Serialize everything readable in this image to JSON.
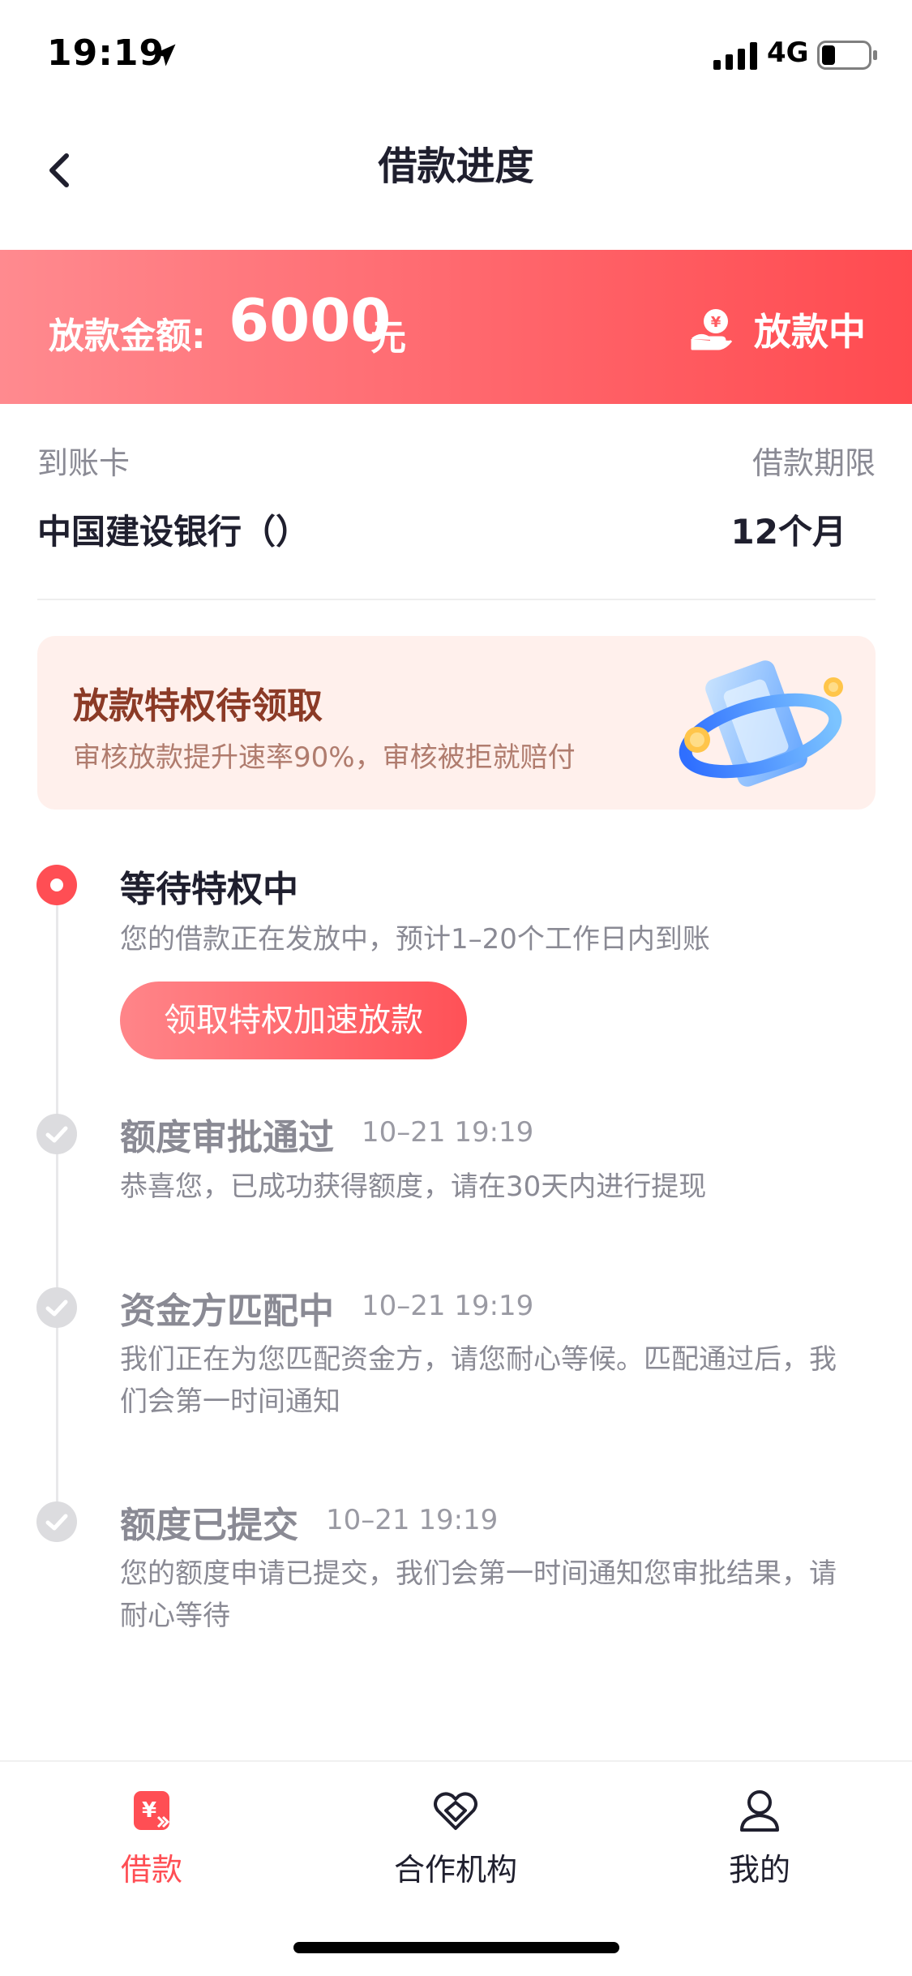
{
  "status_bar": {
    "time": "19:19",
    "network": "4G"
  },
  "header": {
    "title": "借款进度"
  },
  "banner": {
    "amount_label": "放款金额:",
    "amount_value": "6000",
    "amount_unit": "元",
    "status": "放款中"
  },
  "card_info": {
    "card_label": "到账卡",
    "card_value": "中国建设银行（）",
    "term_label": "借款期限",
    "term_value": "12个月"
  },
  "promo": {
    "title": "放款特权待领取",
    "subtitle": "审核放款提升速率90%，审核被拒就赔付"
  },
  "timeline": [
    {
      "title": "等待特权中",
      "time": "",
      "desc": "您的借款正在发放中，预计1–20个工作日内到账",
      "active": true
    },
    {
      "title": "额度审批通过",
      "time": "10–21 19:19",
      "desc": "恭喜您，已成功获得额度，请在30天内进行提现"
    },
    {
      "title": "资金方匹配中",
      "time": "10–21 19:19",
      "desc": "我们正在为您匹配资金方，请您耐心等候。匹配通过后，我们会第一时间通知"
    },
    {
      "title": "额度已提交",
      "time": "10–21 19:19",
      "desc": "您的额度申请已提交，我们会第一时间通知您审批结果，请耐心等待"
    }
  ],
  "claim_button": "领取特权加速放款",
  "tabs": [
    {
      "label": "借款",
      "icon": "loan-icon",
      "active": true
    },
    {
      "label": "合作机构",
      "icon": "handshake-heart-icon"
    },
    {
      "label": "我的",
      "icon": "user-icon"
    }
  ],
  "colors": {
    "accent": "#ff4e54",
    "promo_bg": "#fff0ec",
    "promo_title": "#8b3a26"
  }
}
